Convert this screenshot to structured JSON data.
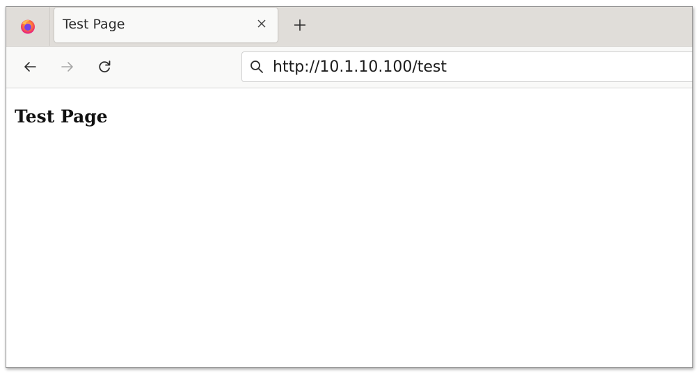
{
  "browser": {
    "tabs": [
      {
        "title": "Test Page",
        "close_icon": "close-icon"
      }
    ],
    "new_tab_icon": "plus-icon",
    "app_icon": "firefox-icon",
    "nav": {
      "back_icon": "back-arrow-icon",
      "forward_icon": "forward-arrow-icon",
      "reload_icon": "reload-icon"
    },
    "url": "http://10.1.10.100/test",
    "accent_colors": {
      "tabbar_bg": "#e0ddd9",
      "toolbar_bg": "#f9f9f8",
      "firefox_orange": "#ff7139",
      "firefox_purple": "#7542e5"
    }
  },
  "page": {
    "heading": "Test Page"
  }
}
